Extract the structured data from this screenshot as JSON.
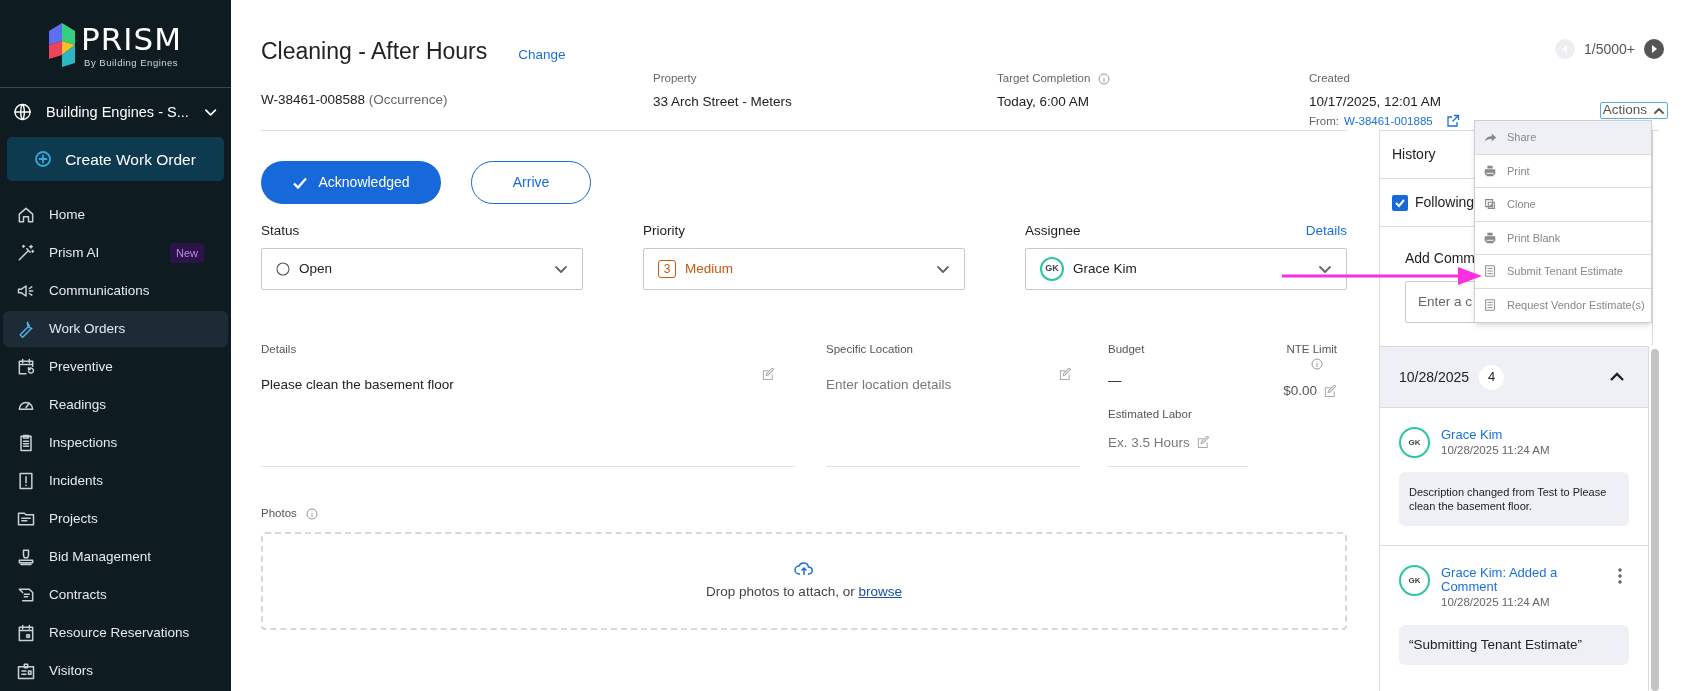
{
  "sidebar": {
    "logo": {
      "name": "PRISM",
      "tagline": "By Building Engines"
    },
    "account_selector": "Building Engines - S...",
    "create_button": "Create Work Order",
    "nav": [
      {
        "label": "Home",
        "selected": false
      },
      {
        "label": "Prism AI",
        "selected": false,
        "badge": "New"
      },
      {
        "label": "Communications",
        "selected": false
      },
      {
        "label": "Work Orders",
        "selected": true
      },
      {
        "label": "Preventive",
        "selected": false
      },
      {
        "label": "Readings",
        "selected": false
      },
      {
        "label": "Inspections",
        "selected": false
      },
      {
        "label": "Incidents",
        "selected": false
      },
      {
        "label": "Projects",
        "selected": false
      },
      {
        "label": "Bid Management",
        "selected": false
      },
      {
        "label": "Contracts",
        "selected": false
      },
      {
        "label": "Resource Reservations",
        "selected": false
      },
      {
        "label": "Visitors",
        "selected": false
      }
    ]
  },
  "header": {
    "title": "Cleaning - After Hours",
    "change_link": "Change",
    "work_order_id": "W-38461-008588",
    "occurrence": "(Occurrence)",
    "property": {
      "label": "Property",
      "value": "33 Arch Street - Meters"
    },
    "target_completion": {
      "label": "Target Completion",
      "value": "Today, 6:00 AM"
    },
    "created": {
      "label": "Created",
      "value": "10/17/2025, 12:01 AM",
      "from_label": "From:",
      "from_link": "W-38461-001885"
    },
    "pager": "1/5000+",
    "actions_button": {
      "label": "Actions",
      "expanded": true
    }
  },
  "actions_menu": [
    {
      "label": "Share",
      "highlighted": true
    },
    {
      "label": "Print",
      "highlighted": false
    },
    {
      "label": "Clone",
      "highlighted": false
    },
    {
      "label": "Print Blank",
      "highlighted": false
    },
    {
      "label": "Submit Tenant Estimate",
      "highlighted": false
    },
    {
      "label": "Request Vendor Estimate(s)",
      "highlighted": false
    }
  ],
  "buttons": [
    {
      "label": "Acknowledged",
      "kind": "primary"
    },
    {
      "label": "Arrive",
      "kind": "outline"
    }
  ],
  "fields": {
    "status": {
      "label": "Status",
      "value": "Open"
    },
    "priority": {
      "label": "Priority",
      "number": "3",
      "value": "Medium"
    },
    "assignee": {
      "label": "Assignee",
      "link": "Details",
      "initials": "GK",
      "value": "Grace Kim"
    }
  },
  "details": {
    "label": "Details",
    "value": "Please clean the basement floor"
  },
  "specific_location": {
    "label": "Specific Location",
    "placeholder": "Enter location details"
  },
  "budget": {
    "label": "Budget",
    "value": "—"
  },
  "nte_limit": {
    "label": "NTE Limit",
    "value": "$0.00"
  },
  "estimated_labor": {
    "label": "Estimated Labor",
    "placeholder": "Ex. 3.5 Hours"
  },
  "photos": {
    "label": "Photos",
    "prompt": "Drop photos to attach, or",
    "link": "browse"
  },
  "history": {
    "title": "History",
    "following": {
      "label": "Following",
      "checked": true
    },
    "add_comment": {
      "label": "Add Comm",
      "placeholder": "Enter a c"
    },
    "group": {
      "date": "10/28/2025",
      "count": "4",
      "expanded": true,
      "entries": [
        {
          "initials": "GK",
          "author": "Grace Kim",
          "time": "10/28/2025 11:24 AM",
          "body": "Description changed from Test to Please clean the basement floor.",
          "has_menu": false
        },
        {
          "initials": "GK",
          "author": "Grace Kim: Added a Comment",
          "time": "10/28/2025 11:24 AM",
          "body": "“Submitting Tenant Estimate”",
          "has_menu": true
        }
      ]
    }
  }
}
